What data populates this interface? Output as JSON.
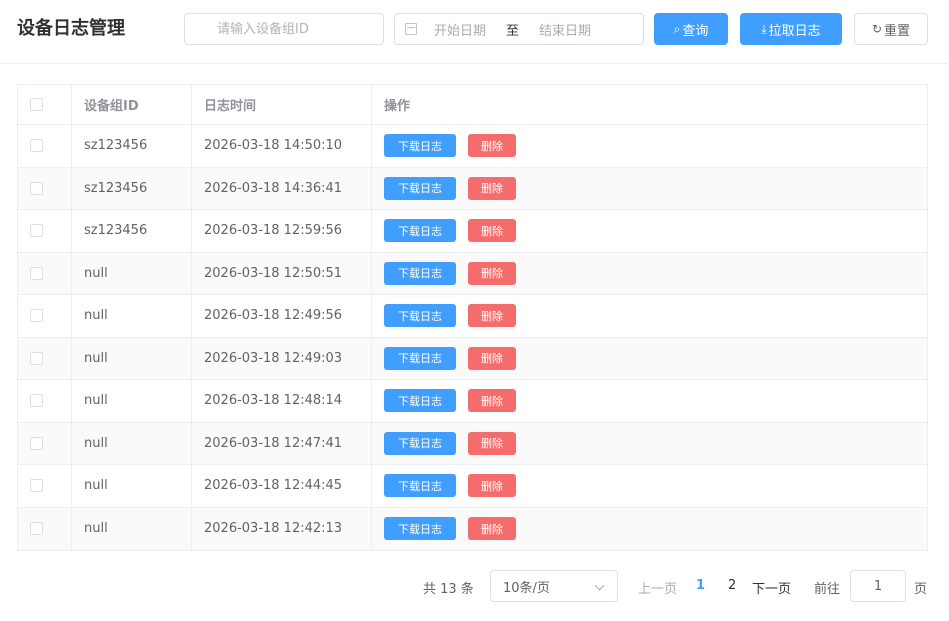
{
  "header": {
    "title": "设备日志管理",
    "search_placeholder": "请输入设备组ID",
    "date_start_placeholder": "开始日期",
    "date_separator": "至",
    "date_end_placeholder": "结束日期",
    "query_label": "查询",
    "pull_label": "拉取日志",
    "reset_label": "重置"
  },
  "table": {
    "columns": [
      "设备组ID",
      "日志时间",
      "操作"
    ],
    "download_label": "下载日志",
    "delete_label": "删除",
    "rows": [
      {
        "id": "sz123456",
        "time": "2026-03-18 14:50:10"
      },
      {
        "id": "sz123456",
        "time": "2026-03-18 14:36:41"
      },
      {
        "id": "sz123456",
        "time": "2026-03-18 12:59:56"
      },
      {
        "id": "null",
        "time": "2026-03-18 12:50:51"
      },
      {
        "id": "null",
        "time": "2026-03-18 12:49:56"
      },
      {
        "id": "null",
        "time": "2026-03-18 12:49:03"
      },
      {
        "id": "null",
        "time": "2026-03-18 12:48:14"
      },
      {
        "id": "null",
        "time": "2026-03-18 12:47:41"
      },
      {
        "id": "null",
        "time": "2026-03-18 12:44:45"
      },
      {
        "id": "null",
        "time": "2026-03-18 12:42:13"
      }
    ]
  },
  "pagination": {
    "total": "共 13 条",
    "page_size": "10条/页",
    "prev": "上一页",
    "pages": [
      "1",
      "2"
    ],
    "next": "下一页",
    "goto_label": "前往",
    "goto_value": "1",
    "page_unit": "页"
  },
  "colors": {
    "primary": "#409eff",
    "danger": "#f56c6c"
  }
}
